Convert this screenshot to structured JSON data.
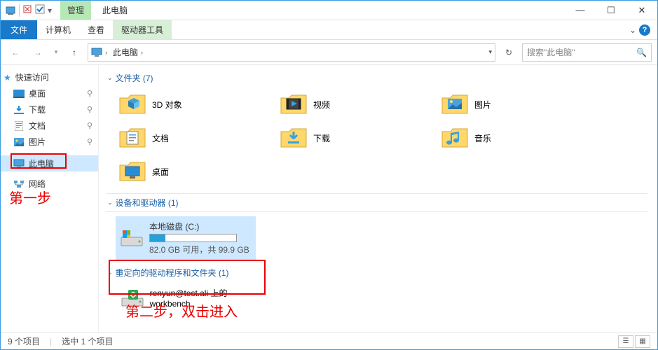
{
  "titlebar": {
    "drive_tab": "管理",
    "title": "此电脑"
  },
  "ribbon": {
    "file": "文件",
    "tabs": [
      "计算机",
      "查看"
    ],
    "drive_tools": "驱动器工具"
  },
  "nav": {
    "breadcrumb_root": "此电脑",
    "search_placeholder": "搜索\"此电脑\""
  },
  "sidebar": {
    "quick": "快速访问",
    "items": [
      "桌面",
      "下载",
      "文档",
      "图片"
    ],
    "thispc": "此电脑",
    "network": "网络"
  },
  "groups": {
    "folders": {
      "title": "文件夹 (7)",
      "items": [
        "3D 对象",
        "视频",
        "图片",
        "文档",
        "下载",
        "音乐",
        "桌面"
      ]
    },
    "devices": {
      "title": "设备和驱动器 (1)",
      "drive_name": "本地磁盘 (C:)",
      "drive_sub": "82.0 GB 可用，共 99.9 GB",
      "fill_pct": 18
    },
    "redirect": {
      "title": "重定向的驱动程序和文件夹 (1)",
      "item": "renyun@test.ali 上的 workbench"
    }
  },
  "status": {
    "count": "9 个项目",
    "sel": "选中 1 个项目"
  },
  "annot": {
    "step1": "第一步",
    "step2": "第二步，双击进入"
  }
}
